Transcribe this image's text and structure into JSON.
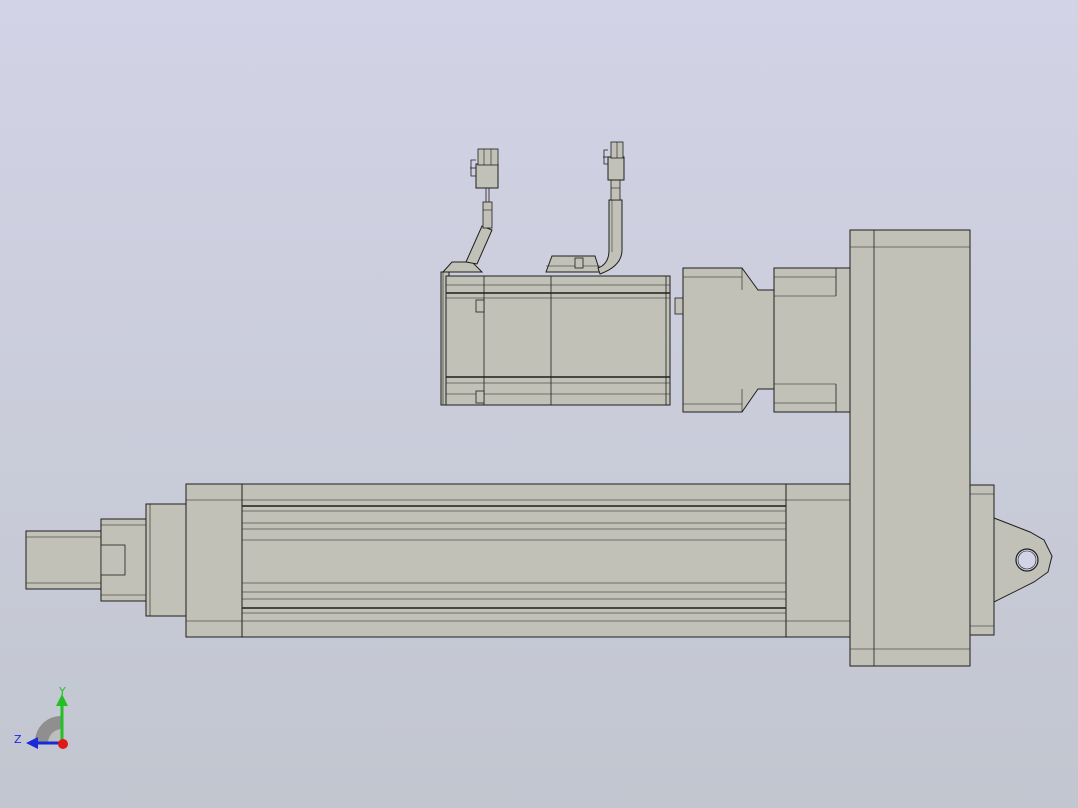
{
  "viewport": {
    "background_top": "#d2d3e6",
    "background_bottom": "#c2c6cf"
  },
  "model": {
    "shade_color": "#c2c1b7",
    "shade_dark": "#9d9c92",
    "edge_color": "#1e1e1e",
    "hole_color": "#d2d3e6"
  },
  "triad": {
    "y_label": "Y",
    "z_label": "Z",
    "x_color": "#e01818",
    "y_color": "#22c022",
    "z_color": "#1a2ad8"
  }
}
